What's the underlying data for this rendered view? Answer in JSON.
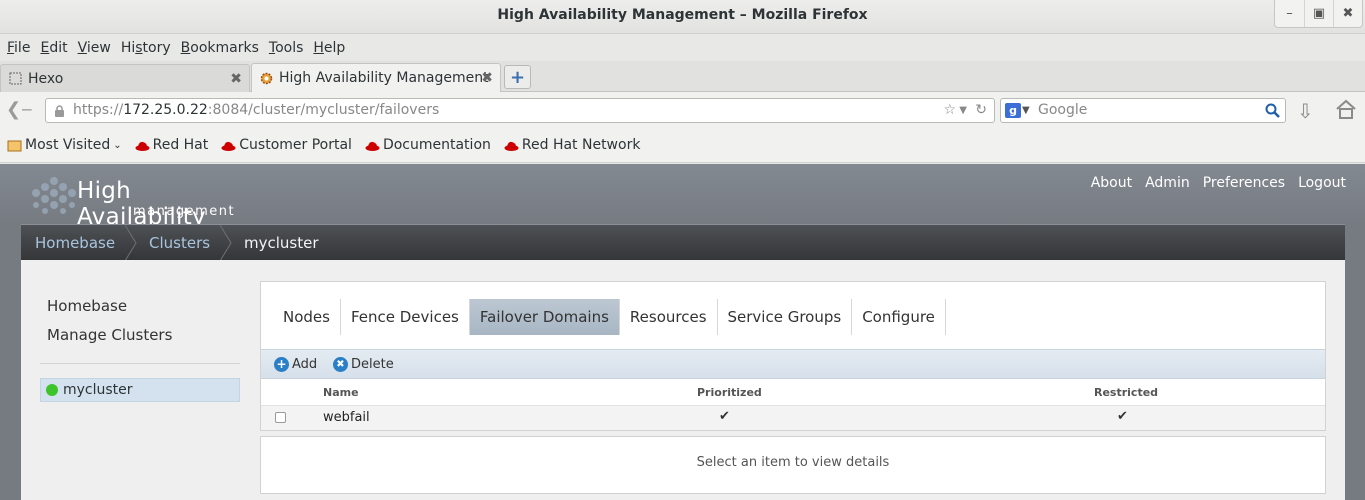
{
  "window": {
    "title": "High Availability Management – Mozilla Firefox",
    "controls": [
      "minimize-icon",
      "maximize-icon",
      "close-icon"
    ]
  },
  "menubar": {
    "items": [
      {
        "label": "File",
        "accel": "F",
        "rest": "ile"
      },
      {
        "label": "Edit",
        "accel": "E",
        "rest": "dit"
      },
      {
        "label": "View",
        "accel": "V",
        "rest": "iew"
      },
      {
        "label": "History",
        "pre": "Hi",
        "accel": "s",
        "rest": "tory"
      },
      {
        "label": "Bookmarks",
        "accel": "B",
        "rest": "ookmarks"
      },
      {
        "label": "Tools",
        "accel": "T",
        "rest": "ools"
      },
      {
        "label": "Help",
        "accel": "H",
        "rest": "elp"
      }
    ]
  },
  "tabs": [
    {
      "label": "Hexo",
      "active": false
    },
    {
      "label": "High Availability Management",
      "active": true
    }
  ],
  "navbar": {
    "url_scheme": "https://",
    "url_host": "172.25.0.22",
    "url_path": ":8084/cluster/mycluster/failovers",
    "search_placeholder": "Google"
  },
  "bookmarks": [
    "Most Visited",
    "Red Hat",
    "Customer Portal",
    "Documentation",
    "Red Hat Network"
  ],
  "app": {
    "brand_title": "High Availability",
    "brand_subtitle": "management",
    "top_links": [
      "About",
      "Admin",
      "Preferences",
      "Logout"
    ],
    "breadcrumb": [
      "Homebase",
      "Clusters",
      "mycluster"
    ],
    "left_nav": [
      "Homebase",
      "Manage Clusters"
    ],
    "cluster": {
      "name": "mycluster",
      "status_color": "#3cc42a"
    },
    "panel_tabs": [
      {
        "label": "Nodes",
        "active": false
      },
      {
        "label": "Fence Devices",
        "active": false
      },
      {
        "label": "Failover Domains",
        "active": true
      },
      {
        "label": "Resources",
        "active": false
      },
      {
        "label": "Service Groups",
        "active": false
      },
      {
        "label": "Configure",
        "active": false
      }
    ],
    "toolbar": {
      "add_label": "Add",
      "delete_label": "Delete"
    },
    "table": {
      "columns": [
        "Name",
        "Prioritized",
        "Restricted"
      ],
      "rows": [
        {
          "name": "webfail",
          "prioritized": true,
          "restricted": true,
          "check_glyph": "✔"
        }
      ]
    },
    "details_message": "Select an item to view details"
  }
}
